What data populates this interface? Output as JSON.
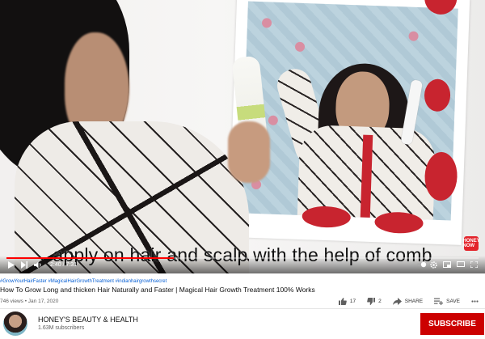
{
  "video": {
    "caption": "apply on hair and scalp with the help of comb",
    "time": "2:40 / 7:31",
    "progress_fraction": 0.355,
    "badge": "HONEY NOW"
  },
  "controls": {
    "icons": [
      "play-icon",
      "next-icon",
      "volume-icon",
      "autoplay-toggle",
      "settings-icon",
      "miniplayer-icon",
      "theater-icon",
      "fullscreen-icon"
    ]
  },
  "info": {
    "hashtags": "#GrowYourHairFaster #MagicalHairGrowthTreatment #indianhairgrowthsecret",
    "title": "How To Grow Long and thicken Hair Naturally and Faster | Magical Hair Growth Treatment 100% Works",
    "meta": "746 views • Jan 17, 2020"
  },
  "actions": {
    "likes": "17",
    "dislikes": "2",
    "share": "SHARE",
    "save": "SAVE"
  },
  "channel": {
    "name": "HONEY'S BEAUTY & HEALTH",
    "subscribers": "1.63M subscribers",
    "subscribe_label": "SUBSCRIBE"
  },
  "colors": {
    "progress": "#ff0000",
    "subscribe": "#cc0000",
    "link": "#065fd4"
  }
}
